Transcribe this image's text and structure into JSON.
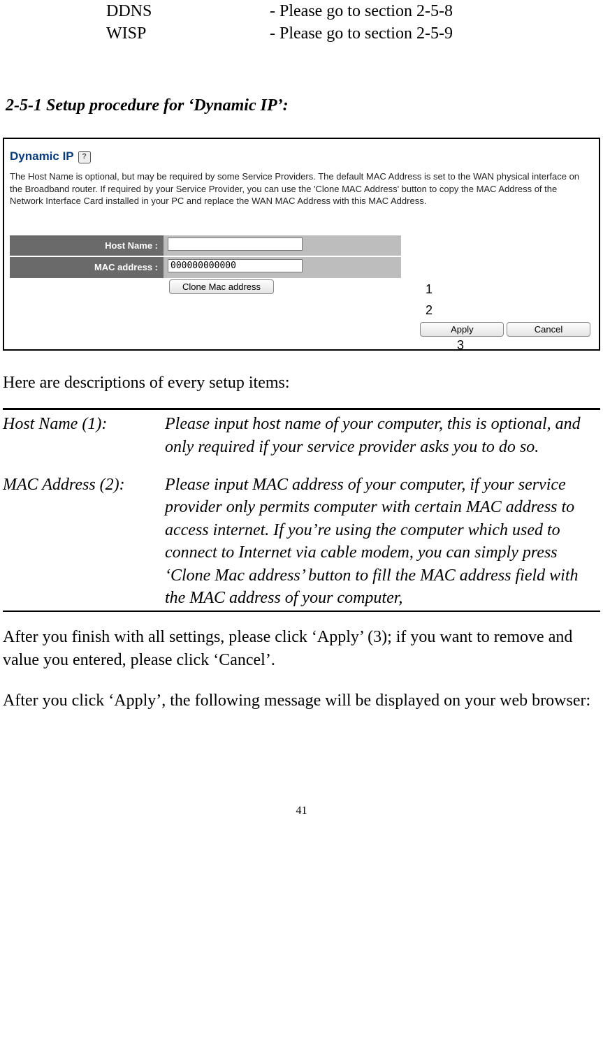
{
  "top": {
    "row1_label": "DDNS",
    "row1_text": "- Please go to section 2-5-8",
    "row2_label": "WISP",
    "row2_text": "- Please go to section 2-5-9"
  },
  "heading": "2-5-1 Setup procedure for ‘Dynamic IP’:",
  "screenshot": {
    "title": "Dynamic IP",
    "help_icon": "?",
    "description": "The Host Name is optional, but may be required by some Service Providers. The default MAC Address is set to the WAN physical interface on the Broadband router. If required by your Service Provider, you can use the 'Clone MAC Address' button to copy the MAC Address of the Network Interface Card installed in your PC and replace the WAN MAC Address with this MAC Address.",
    "host_label": "Host Name :",
    "host_value": "",
    "mac_label": "MAC address :",
    "mac_value": "000000000000",
    "clone_btn": "Clone Mac address",
    "apply_btn": "Apply",
    "cancel_btn": "Cancel",
    "callout1": "1",
    "callout2": "2",
    "callout3": "3"
  },
  "after_shot": "Here are descriptions of every setup items:",
  "items": {
    "host_label": "Host Name (1):",
    "host_desc": "Please input host name of your computer, this is optional, and only required if your service provider asks you to do so.",
    "mac_label": "MAC Address (2):",
    "mac_desc": "Please input MAC address of your computer, if your service provider only permits computer with certain MAC address to access internet. If you’re using the computer which used to connect to Internet via cable modem, you can simply press ‘Clone Mac address’ button to fill the MAC address field with the MAC address of your computer,"
  },
  "para1": "After you finish with all settings, please click ‘Apply’ (3); if you want to remove and value you entered, please click ‘Cancel’.",
  "para2": "After you click ‘Apply’, the following message will be displayed on your web browser:",
  "page_number": "41"
}
